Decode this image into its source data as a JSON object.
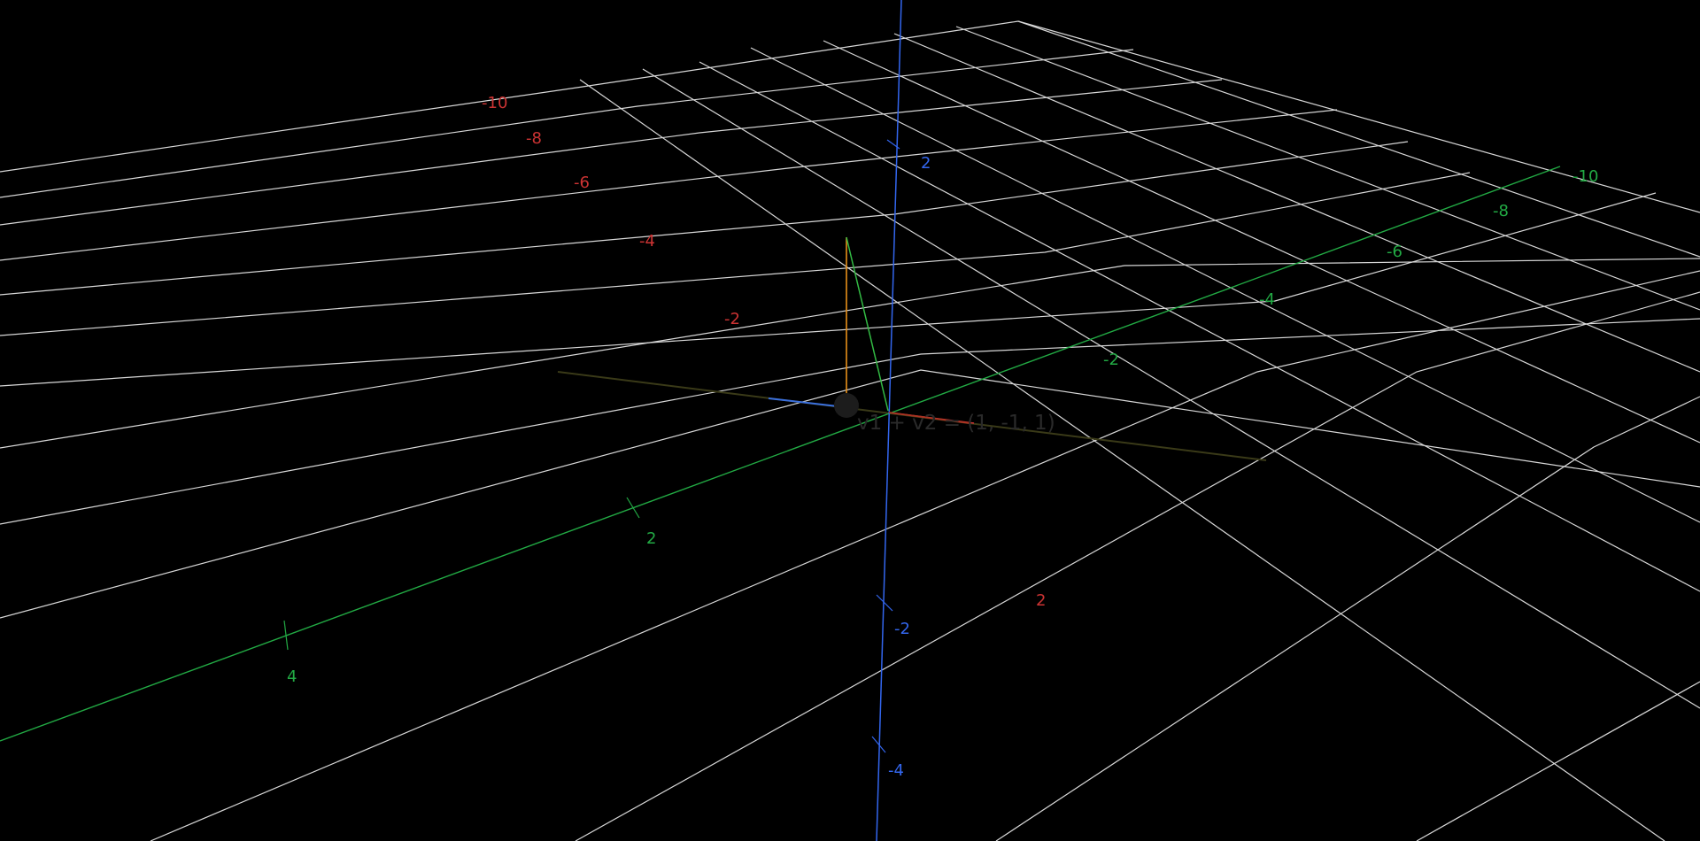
{
  "colors": {
    "background": "#000000",
    "grid": "#d8d8d8",
    "x_axis": "#cc3333",
    "y_axis": "#22aa44",
    "z_axis": "#3366ee",
    "vector_orange": "#e8901a",
    "vector_green": "#33bb44",
    "vector_label": "#2a2a2a"
  },
  "axes": {
    "x": {
      "name": "x",
      "ticks": [
        {
          "text": "-10"
        },
        {
          "text": "-8"
        },
        {
          "text": "-6"
        },
        {
          "text": "-4"
        },
        {
          "text": "-2"
        },
        {
          "text": "2"
        }
      ]
    },
    "y": {
      "name": "y",
      "ticks": [
        {
          "text": "-10"
        },
        {
          "text": "-8"
        },
        {
          "text": "-6"
        },
        {
          "text": "-4"
        },
        {
          "text": "-2"
        },
        {
          "text": "2"
        },
        {
          "text": "4"
        }
      ]
    },
    "z": {
      "name": "z",
      "ticks": [
        {
          "text": "2"
        },
        {
          "text": "-2"
        },
        {
          "text": "-4"
        }
      ]
    }
  },
  "vectors": {
    "sum_label": "v1 + v2 = (1, -1, 1)"
  }
}
